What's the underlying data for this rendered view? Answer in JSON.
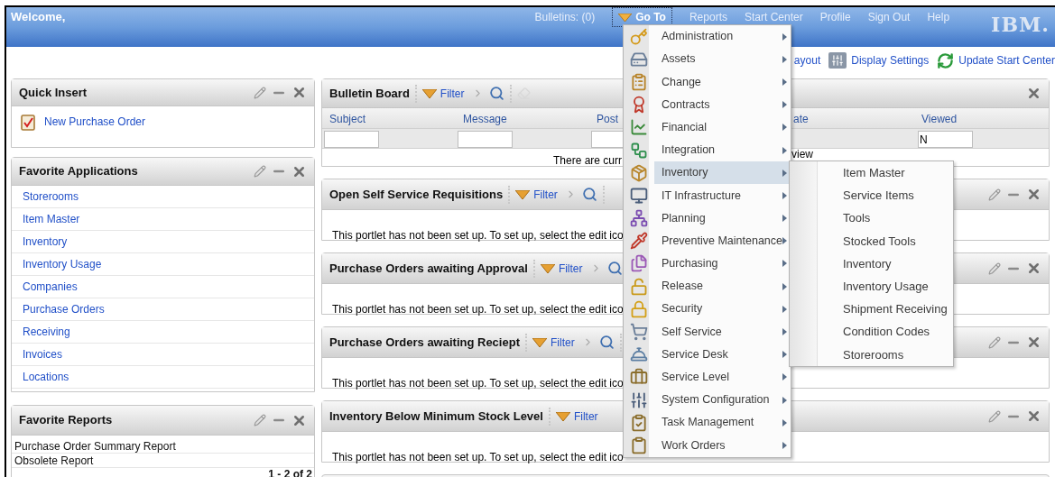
{
  "header": {
    "welcome": "Welcome,",
    "nav": [
      {
        "label": "Bulletins: (0)",
        "kind": "link",
        "expanded": false
      },
      {
        "label": "Go To",
        "kind": "menu",
        "expanded": true
      },
      {
        "label": "Reports",
        "kind": "link",
        "expanded": false
      },
      {
        "label": "Start Center",
        "kind": "link",
        "expanded": false
      },
      {
        "label": "Profile",
        "kind": "link",
        "expanded": false
      },
      {
        "label": "Sign Out",
        "kind": "link",
        "expanded": false
      },
      {
        "label": "Help",
        "kind": "link",
        "expanded": false
      }
    ],
    "logo": "IBM."
  },
  "toolbar": [
    {
      "label": "ayout",
      "kind": "plain"
    },
    {
      "label": "Display Settings",
      "kind": "sliders"
    },
    {
      "label": "Update Start Center",
      "kind": "refresh"
    }
  ],
  "quick_insert": {
    "title": "Quick Insert",
    "items": [
      "New Purchase Order"
    ]
  },
  "favorite_applications": {
    "title": "Favorite Applications",
    "items": [
      "Storerooms",
      "Item Master",
      "Inventory",
      "Inventory Usage",
      "Companies",
      "Purchase Orders",
      "Receiving",
      "Invoices",
      "Locations"
    ]
  },
  "favorite_reports": {
    "title": "Favorite Reports",
    "items": [
      "Purchase Order Summary Report",
      "Obsolete Report"
    ],
    "pager": "1 - 2 of 2"
  },
  "bulletin_board": {
    "title": "Bulletin Board",
    "filter_label": "Filter",
    "columns": [
      {
        "label": "Subject",
        "has_filter": true
      },
      {
        "label": "Message",
        "has_filter": true
      },
      {
        "label": "Post",
        "has_filter": true
      },
      {
        "label": "ate",
        "has_filter": false
      },
      {
        "label": "Viewed",
        "has_filter": true,
        "filter_value": "N"
      }
    ],
    "message_left": "There are curr",
    "message_right": "view"
  },
  "portlets": [
    {
      "title": "Open Self Service Requisitions",
      "filter_label": "Filter",
      "search_icon": true,
      "body": "This portlet has not been set up. To set up, select the edit ico"
    },
    {
      "title": "Purchase Orders awaiting Approval",
      "filter_label": "Filter",
      "search_icon": true,
      "body": "This portlet has not been set up. To set up, select the edit ico"
    },
    {
      "title": "Purchase Orders awaiting Reciept",
      "filter_label": "Filter",
      "search_icon": true,
      "body": "This portlet has not been set up. To set up, select the edit ico"
    },
    {
      "title": "Inventory Below Minimum Stock Level",
      "filter_label": "Filter",
      "search_icon": false,
      "body": "This portlet has not been set up. To set up, select the edit ico"
    }
  ],
  "goto_menu": {
    "items": [
      {
        "label": "Administration",
        "selected": false
      },
      {
        "label": "Assets",
        "selected": false
      },
      {
        "label": "Change",
        "selected": false
      },
      {
        "label": "Contracts",
        "selected": false
      },
      {
        "label": "Financial",
        "selected": false
      },
      {
        "label": "Integration",
        "selected": false
      },
      {
        "label": "Inventory",
        "selected": true,
        "submenu": [
          "Item Master",
          "Service Items",
          "Tools",
          "Stocked Tools",
          "Inventory",
          "Inventory Usage",
          "Shipment Receiving",
          "Condition Codes",
          "Storerooms"
        ]
      },
      {
        "label": "IT Infrastructure",
        "selected": false
      },
      {
        "label": "Planning",
        "selected": false
      },
      {
        "label": "Preventive Maintenance",
        "selected": false
      },
      {
        "label": "Purchasing",
        "selected": false
      },
      {
        "label": "Release",
        "selected": false
      },
      {
        "label": "Security",
        "selected": false
      },
      {
        "label": "Self Service",
        "selected": false
      },
      {
        "label": "Service Desk",
        "selected": false
      },
      {
        "label": "Service Level",
        "selected": false
      },
      {
        "label": "System Configuration",
        "selected": false
      },
      {
        "label": "Task Management",
        "selected": false
      },
      {
        "label": "Work Orders",
        "selected": false
      }
    ]
  }
}
